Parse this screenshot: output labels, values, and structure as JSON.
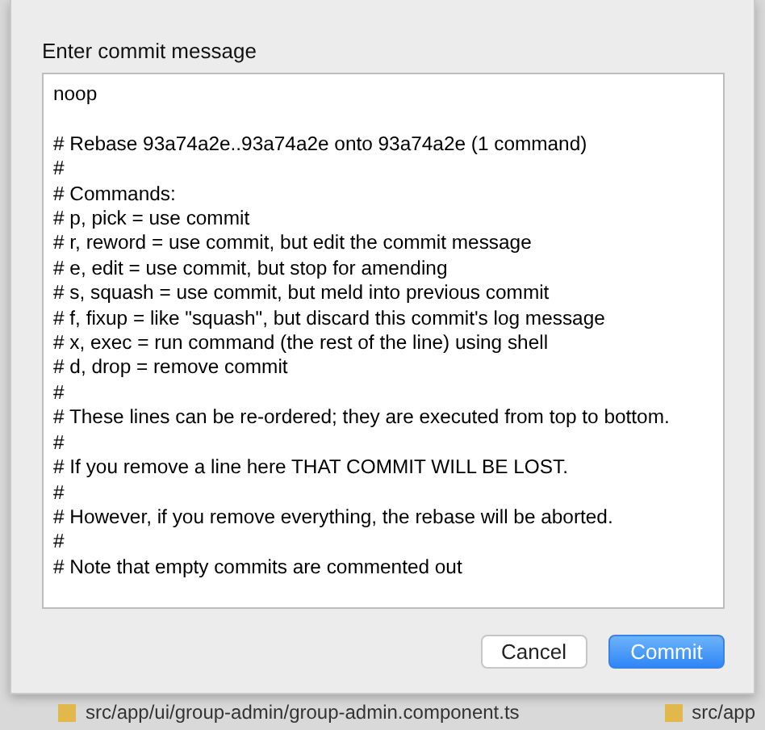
{
  "dialog": {
    "title": "Enter commit message",
    "message": "noop\n\n# Rebase 93a74a2e..93a74a2e onto 93a74a2e (1 command)\n#\n# Commands:\n# p, pick = use commit\n# r, reword = use commit, but edit the commit message\n# e, edit = use commit, but stop for amending\n# s, squash = use commit, but meld into previous commit\n# f, fixup = like \"squash\", but discard this commit's log message\n# x, exec = run command (the rest of the line) using shell\n# d, drop = remove commit\n#\n# These lines can be re-ordered; they are executed from top to bottom.\n#\n# If you remove a line here THAT COMMIT WILL BE LOST.\n#\n# However, if you remove everything, the rebase will be aborted.\n#\n# Note that empty commits are commented out",
    "buttons": [
      {
        "label": "Cancel",
        "kind": "secondary"
      },
      {
        "label": "Commit",
        "kind": "primary"
      }
    ]
  },
  "background_files": [
    {
      "path": "src/app/ui/group-admin/group-admin.component.ts"
    },
    {
      "path": "src/app"
    }
  ]
}
